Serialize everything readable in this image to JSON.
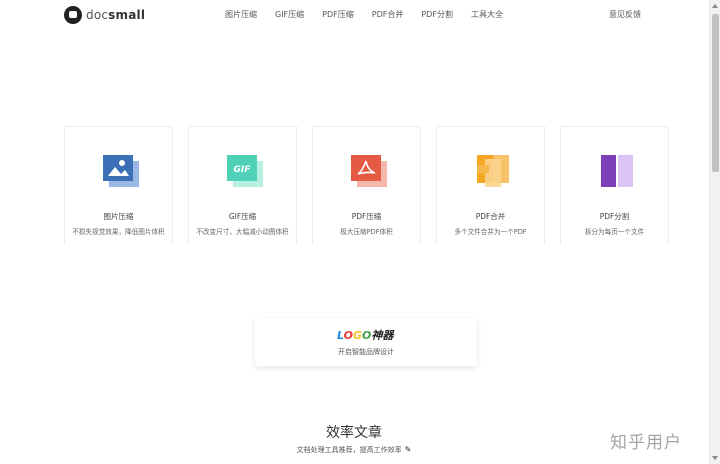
{
  "header": {
    "logo_doc": "doc",
    "logo_small": "small",
    "nav": [
      "图片压缩",
      "GIF压缩",
      "PDF压缩",
      "PDF合并",
      "PDF分割",
      "工具大全"
    ],
    "feedback": "意见反馈"
  },
  "tools": [
    {
      "title": "图片压缩",
      "desc": "不损失视觉效果，降低图片体积",
      "icon": "image-icon",
      "color": "#3b6fb6"
    },
    {
      "title": "GIF压缩",
      "desc": "不改变尺寸，大幅减小动图体积",
      "icon": "gif-icon",
      "color": "#4fd1b8"
    },
    {
      "title": "PDF压缩",
      "desc": "极大压缩PDF体积",
      "icon": "pdf-icon",
      "color": "#e55a45"
    },
    {
      "title": "PDF合并",
      "desc": "多个文件合并为一个PDF",
      "icon": "merge-icon",
      "color": "#f5a623"
    },
    {
      "title": "PDF分割",
      "desc": "拆分为每页一个文件",
      "icon": "split-icon",
      "color": "#7b3fb8"
    }
  ],
  "banner": {
    "logo_letters": [
      "L",
      "O",
      "G",
      "O"
    ],
    "logo_zh": "神器",
    "subtitle": "开启智能品牌设计"
  },
  "articles": {
    "title": "效率文章",
    "subtitle": "文档处理工具推荐，提高工作效率"
  },
  "watermark": "知乎用户"
}
